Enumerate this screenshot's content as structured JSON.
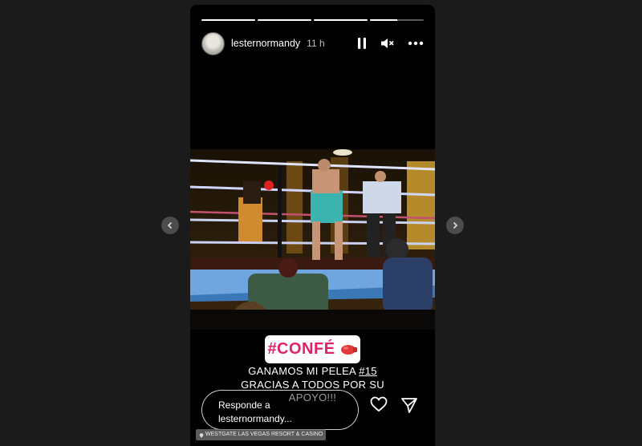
{
  "story": {
    "username": "lesternormandy",
    "time_ago": "11 h",
    "progress": [
      1,
      1,
      1,
      0.5
    ],
    "sticker_text": "#CONFÉ",
    "sticker_emoji_icon": "boxing-glove-icon",
    "caption_pre": "GANAMOS MI PELEA ",
    "caption_hashtag": "#15",
    "caption_post": " GRACIAS A TODOS POR SU APOYO!!!",
    "location": "WESTGATE LAS VEGAS RESORT & CASINO"
  },
  "reply": {
    "placeholder": "Responde a lesternormandy..."
  },
  "icons": {
    "pause": "pause-icon",
    "mute": "mute-icon",
    "more": "more-icon",
    "like": "heart-icon",
    "share": "send-icon",
    "prev": "chevron-left-icon",
    "next": "chevron-right-icon"
  },
  "colors": {
    "sticker_text": "#e0226a",
    "background": "#1b1b1b"
  }
}
